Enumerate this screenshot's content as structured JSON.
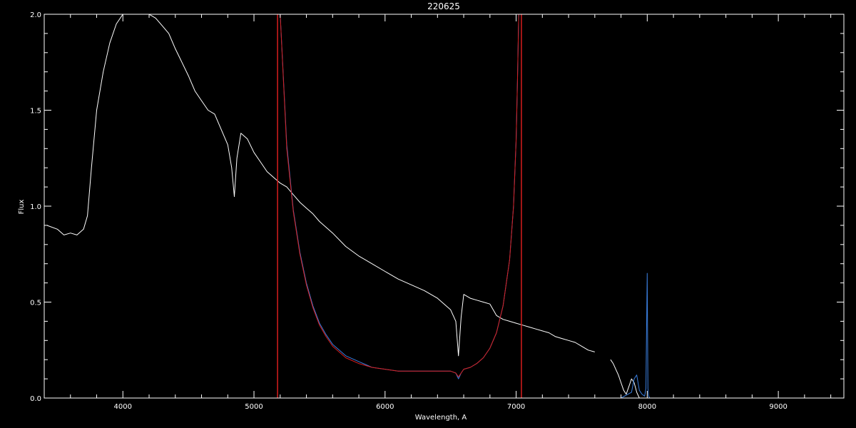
{
  "chart_data": {
    "type": "line",
    "title": "220625",
    "xlabel": "Wavelength, A",
    "ylabel": "Flux",
    "xlim": [
      3400,
      9500
    ],
    "ylim": [
      0.0,
      2.0
    ],
    "xticks": [
      4000,
      5000,
      6000,
      7000,
      8000,
      9000
    ],
    "yticks": [
      0.0,
      0.5,
      1.0,
      1.5,
      2.0
    ],
    "ytick_labels": [
      "0.0",
      "0.5",
      "1.0",
      "1.5",
      "2.0"
    ],
    "grid": false,
    "colors": {
      "background": "#000000",
      "axes": "#ffffff",
      "spectrum": "#ffffff",
      "response": "#3a7fe0",
      "fit": "#d81e1e",
      "vlines": "#d81e1e"
    },
    "vlines": [
      5180,
      7040
    ],
    "series": [
      {
        "color": "#ffffff",
        "x": [
          3420,
          3500,
          3550,
          3600,
          3650,
          3700,
          3730,
          3760,
          3800,
          3850,
          3900,
          3950,
          4000,
          4050,
          4100,
          4150,
          4200,
          4250,
          4300,
          4350,
          4400,
          4450,
          4500,
          4550,
          4600,
          4650,
          4700,
          4750,
          4800,
          4830,
          4850,
          4870,
          4900,
          4950,
          5000,
          5050,
          5100,
          5150,
          5200,
          5250,
          5300,
          5350,
          5400,
          5450,
          5500,
          5600,
          5700,
          5800,
          5900,
          6000,
          6100,
          6200,
          6300,
          6400,
          6500,
          6540,
          6560,
          6580,
          6600,
          6650,
          6700,
          6750,
          6800,
          6850,
          6900,
          6950,
          7000,
          7050,
          7100,
          7150,
          7200,
          7250,
          7300,
          7350,
          7400,
          7450,
          7500,
          7550,
          7600
        ],
        "y": [
          0.9,
          0.88,
          0.85,
          0.86,
          0.85,
          0.88,
          0.95,
          1.2,
          1.5,
          1.7,
          1.85,
          1.95,
          2.0,
          2.0,
          2.0,
          2.0,
          2.0,
          1.98,
          1.94,
          1.9,
          1.82,
          1.75,
          1.68,
          1.6,
          1.55,
          1.5,
          1.48,
          1.4,
          1.32,
          1.2,
          1.05,
          1.25,
          1.38,
          1.35,
          1.28,
          1.23,
          1.18,
          1.15,
          1.12,
          1.1,
          1.06,
          1.02,
          0.99,
          0.96,
          0.92,
          0.86,
          0.79,
          0.74,
          0.7,
          0.66,
          0.62,
          0.59,
          0.56,
          0.52,
          0.46,
          0.4,
          0.22,
          0.42,
          0.54,
          0.52,
          0.51,
          0.5,
          0.49,
          0.43,
          0.41,
          0.4,
          0.39,
          0.38,
          0.37,
          0.36,
          0.35,
          0.34,
          0.32,
          0.31,
          0.3,
          0.29,
          0.27,
          0.25,
          0.24
        ]
      },
      {
        "color": "#ffffff",
        "x": [
          7720,
          7740,
          7760,
          7780,
          7800,
          7820,
          7840,
          7860,
          7880,
          7900,
          7920,
          7940
        ],
        "y": [
          0.2,
          0.18,
          0.15,
          0.12,
          0.08,
          0.04,
          0.02,
          0.06,
          0.1,
          0.08,
          0.03,
          0.0
        ]
      },
      {
        "color": "#3a7fe0",
        "x": [
          3420,
          4000,
          4500,
          5000,
          5200,
          5300,
          5400,
          5500,
          5700,
          5900,
          6000,
          6200,
          6400,
          6500,
          6540,
          6560,
          6580,
          6600,
          6700,
          6800,
          6900,
          6950,
          7000,
          7020,
          7040,
          7100,
          7500,
          7800,
          7880,
          7900,
          7920,
          7940,
          7960,
          7980,
          7990,
          8000,
          8005,
          8010,
          8020,
          8060,
          8100,
          8500,
          9000,
          9500
        ],
        "y": [
          0.0,
          0.0,
          0.0,
          0.0,
          0.0,
          0.0,
          0.0,
          0.0,
          0.0,
          0.0,
          0.0,
          0.0,
          0.0,
          0.0,
          0.0,
          0.0,
          0.0,
          0.0,
          0.0,
          0.0,
          0.0,
          0.0,
          0.0,
          0.0,
          0.0,
          0.0,
          0.0,
          0.0,
          0.03,
          0.1,
          0.12,
          0.04,
          0.02,
          0.01,
          0.05,
          0.65,
          0.05,
          0.01,
          0.0,
          0.0,
          0.0,
          0.0,
          0.0,
          0.0
        ]
      },
      {
        "color": "#3a7fe0",
        "x": [
          5200,
          5250,
          5300,
          5350,
          5400,
          5450,
          5500,
          5550,
          5600,
          5700,
          5800,
          5900,
          6000,
          6100,
          6200,
          6300,
          6400,
          6500,
          6540,
          6560,
          6580,
          6600,
          6650,
          6700,
          6750,
          6800,
          6850,
          6900,
          6950,
          6980,
          7000,
          7010,
          7020
        ],
        "y": [
          2.0,
          1.32,
          0.98,
          0.76,
          0.6,
          0.48,
          0.39,
          0.33,
          0.28,
          0.22,
          0.19,
          0.16,
          0.15,
          0.14,
          0.14,
          0.14,
          0.14,
          0.14,
          0.13,
          0.1,
          0.13,
          0.15,
          0.16,
          0.18,
          0.21,
          0.26,
          0.34,
          0.48,
          0.72,
          1.0,
          1.35,
          1.65,
          2.0
        ]
      },
      {
        "color": "#d81e1e",
        "x": [
          5200,
          5250,
          5300,
          5350,
          5400,
          5450,
          5500,
          5550,
          5600,
          5700,
          5800,
          5900,
          6000,
          6100,
          6200,
          6300,
          6400,
          6500,
          6540,
          6560,
          6580,
          6600,
          6650,
          6700,
          6750,
          6800,
          6850,
          6900,
          6950,
          6980,
          7000,
          7010,
          7020
        ],
        "y": [
          2.0,
          1.3,
          0.97,
          0.75,
          0.59,
          0.47,
          0.38,
          0.32,
          0.27,
          0.21,
          0.18,
          0.16,
          0.15,
          0.14,
          0.14,
          0.14,
          0.14,
          0.14,
          0.13,
          0.11,
          0.13,
          0.15,
          0.16,
          0.18,
          0.21,
          0.26,
          0.34,
          0.48,
          0.72,
          1.0,
          1.35,
          1.65,
          2.0
        ]
      }
    ]
  }
}
